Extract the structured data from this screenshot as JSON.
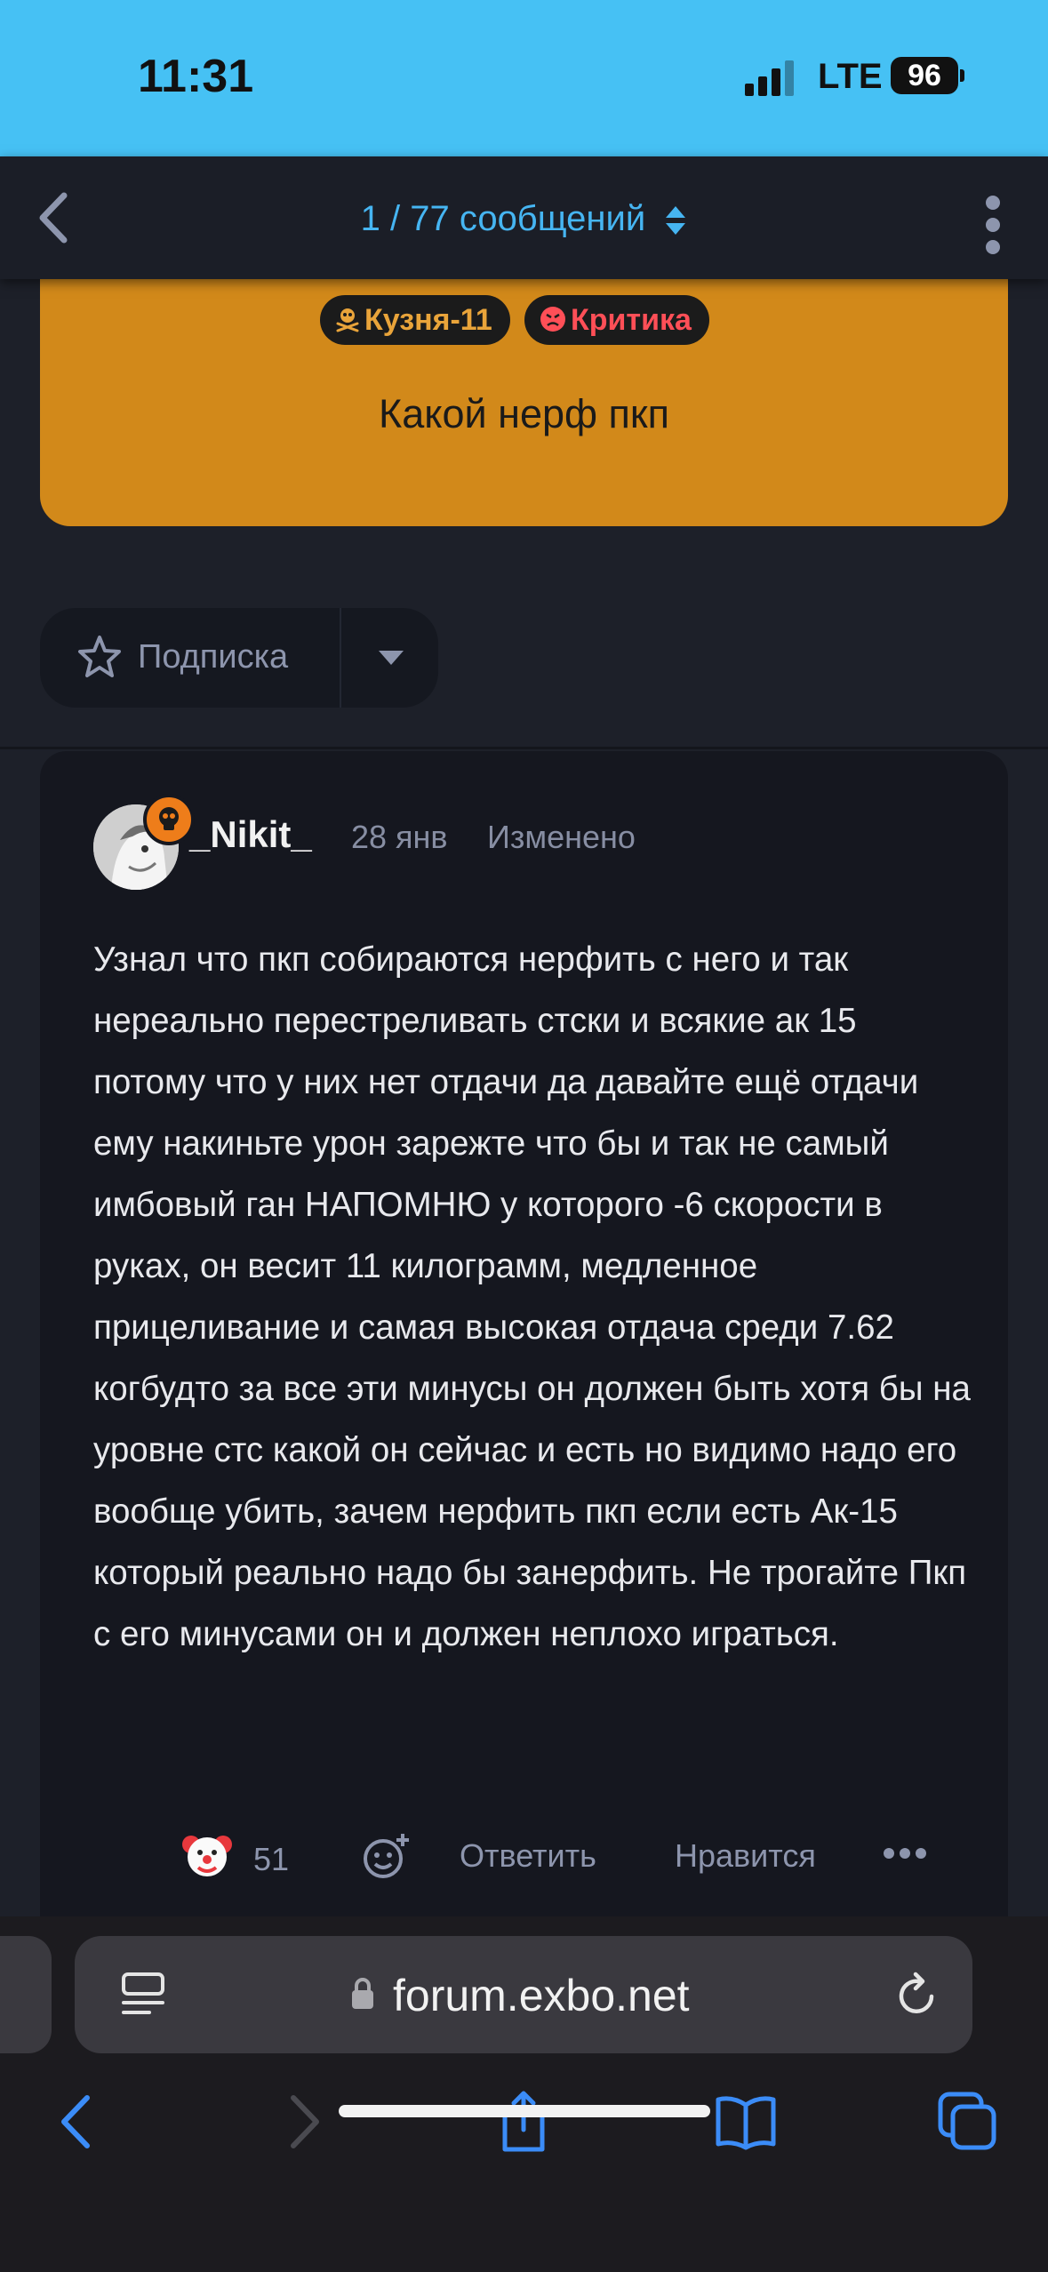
{
  "status_bar": {
    "time": "11:31",
    "network": "LTE",
    "battery": "96",
    "bg_color": "#46c1f4"
  },
  "header": {
    "counter_current": "1",
    "counter_rest": " / 77 сообщений",
    "icons": [
      "chevron-left-icon",
      "sort-icon",
      "more-vertical-icon"
    ]
  },
  "discussion": {
    "tags": [
      {
        "label": "Кузня-11",
        "icon": "skull-crossbones-icon",
        "color": "#e9a43a"
      },
      {
        "label": "Критика",
        "icon": "angry-face-icon",
        "color": "#ff4f57"
      }
    ],
    "title": "Какой нерф пкп",
    "accent_color": "#d2891a"
  },
  "subscribe": {
    "label": "Подписка"
  },
  "post": {
    "author": "_Nikit_",
    "date": "28 янв",
    "edited": "Изменено",
    "text": "Узнал что пкп собираются нерфить с него и так нереально перестреливать стски и всякие ак 15 потому что у них нет отдачи да давайте ещё отдачи ему накиньте урон зарежте что бы и так не самый имбовый ган НАПОМНЮ у которого -6 скорости в руках, он весит 11 килограмм, медленное прицеливание и самая высокая отдача среди 7.62 когбудто за все эти минусы он должен быть хотя бы на уровне стс какой он сейчас и есть но видимо надо его вообще убить, зачем нерфить пкп если есть Ак-15 который реально надо бы занерфить. Не трогайте Пкп с его минусами он и должен неплохо играться.",
    "reaction_icon": "clown-face-icon",
    "reaction_count": "51",
    "reply_label": "Ответить",
    "like_label": "Нравится"
  },
  "browser": {
    "url": "forum.exbo.net",
    "icons": [
      "reader-icon",
      "lock-icon",
      "reload-icon",
      "back-icon",
      "forward-icon",
      "share-icon",
      "bookmarks-icon",
      "tabs-icon"
    ]
  }
}
